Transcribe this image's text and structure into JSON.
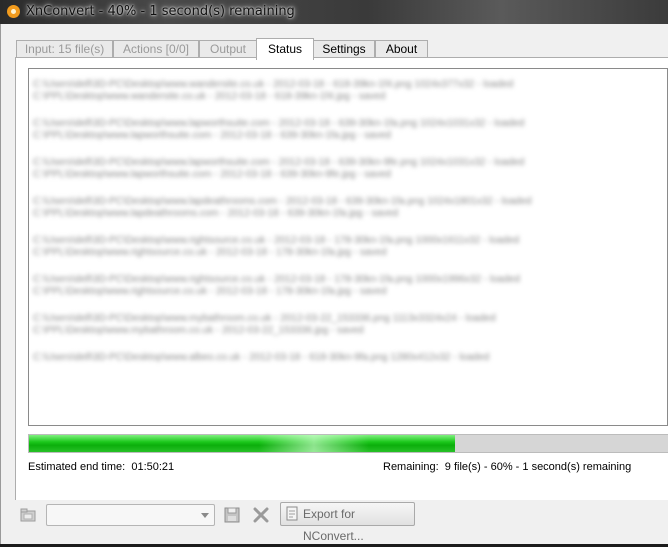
{
  "window": {
    "title": "XnConvert - 40% - 1 second(s) remaining"
  },
  "tabs": [
    {
      "label": "Input: 15 file(s)",
      "state": "disabled"
    },
    {
      "label": "Actions [0/0]",
      "state": "disabled"
    },
    {
      "label": "Output",
      "state": "disabled"
    },
    {
      "label": "Status",
      "state": "active"
    },
    {
      "label": "Settings",
      "state": "enabled"
    },
    {
      "label": "About",
      "state": "enabled"
    }
  ],
  "status": {
    "progress_percent": 40,
    "estimated_end_label": "Estimated end time:",
    "estimated_end_value": "01:50:21",
    "remaining_label": "Remaining:",
    "remaining_value": "9 file(s) - 60% - 1 second(s) remaining"
  },
  "bottombar": {
    "preset_value": "",
    "export_label": "Export for NConvert..."
  },
  "colors": {
    "progress_fill": "#13b813",
    "progress_track": "#d6d6d6",
    "panel_bg": "#ffffff",
    "window_bg": "#f0f0f0"
  },
  "icons": [
    "xnconvert-app-icon",
    "open-folder-icon",
    "save-icon",
    "delete-icon",
    "export-icon"
  ]
}
